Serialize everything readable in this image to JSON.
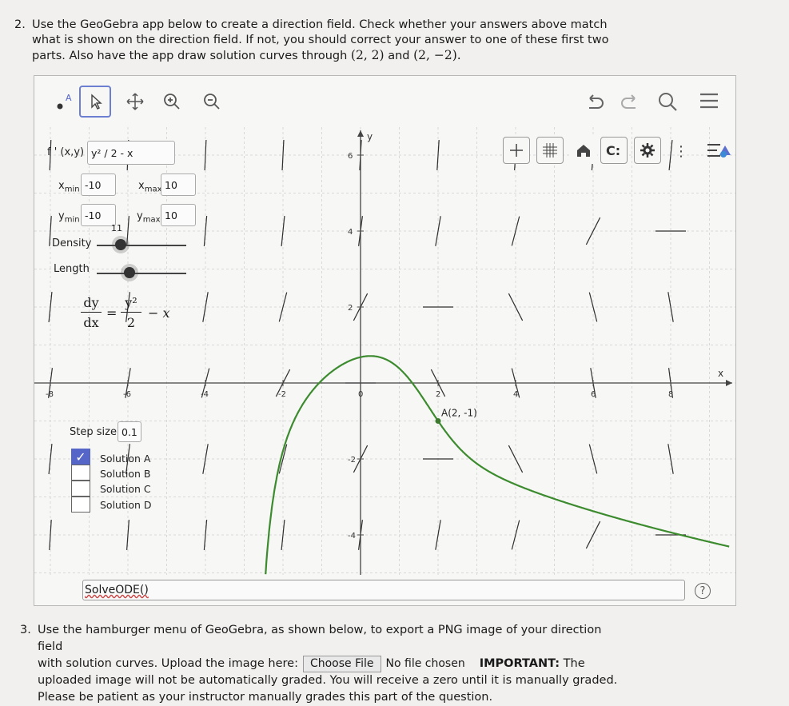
{
  "question2": {
    "number": "2.",
    "line1": "Use the GeoGebra app below to create a direction field. Check whether your answers above match",
    "line2": "what is shown on the direction field. If not, you should correct your answer to one of these first two",
    "line3_pre": "parts. Also have the app draw solution curves through",
    "point1": "(2, 2)",
    "and": "and",
    "point2": "(2, −2).",
    "period": ""
  },
  "toolbar": {
    "tools": [
      "point-tool",
      "move-tool",
      "move-graphics-tool",
      "zoom-in-tool",
      "zoom-out-tool"
    ],
    "point_label": "A",
    "right_tools": [
      "undo",
      "redo",
      "search",
      "menu"
    ]
  },
  "style_bar": [
    "move-graphics",
    "grid",
    "home",
    "label",
    "settings",
    "more",
    "tabs"
  ],
  "sidebar": {
    "function_label": "f ' (x,y) =",
    "function_value": "y² / 2 - x",
    "xmin_label": "x",
    "xmin_sub": "min",
    "xmin_value": "-10",
    "xmax_label": "x",
    "xmax_sub": "max",
    "xmax_value": "10",
    "ymin_label": "y",
    "ymin_sub": "min",
    "ymin_value": "-10",
    "ymax_label": "y",
    "ymax_sub": "max",
    "ymax_value": "10",
    "density_value": "11",
    "density_label": "Density",
    "length_label": "Length",
    "equation_lhs_num": "dy",
    "equation_lhs_den": "dx",
    "equation_eq": "=",
    "equation_rhs_num": "y²",
    "equation_rhs_den": "2",
    "equation_rhs_tail": "− x",
    "step_label": "Step size:",
    "step_value": "0.1",
    "solutions": [
      {
        "label": "Solution A",
        "checked": true
      },
      {
        "label": "Solution B",
        "checked": false
      },
      {
        "label": "Solution C",
        "checked": false
      },
      {
        "label": "Solution D",
        "checked": false
      }
    ]
  },
  "graph": {
    "x_ticks": [
      "-8",
      "-6",
      "-4",
      "-2",
      "0",
      "2",
      "4",
      "6",
      "8"
    ],
    "y_ticks": [
      "6",
      "4",
      "2",
      "-2",
      "-4"
    ],
    "x_axis_label": "x",
    "y_axis_label": "y",
    "point_label": "A(2, -1)",
    "point": {
      "x": 2,
      "y": -1
    }
  },
  "input_bar": {
    "value": "SolveODE()"
  },
  "help_icon_text": "?",
  "question3": {
    "number": "3.",
    "line1": "Use the hamburger menu of GeoGebra, as shown below, to export a PNG image of your direction field",
    "line2_pre": "with solution curves. Upload the image here:",
    "choose_file": "Choose File",
    "no_file": "No file chosen",
    "important": "IMPORTANT:",
    "line2_post": "The",
    "line3": "uploaded image will not be automatically graded. You will receive a zero until it is manually graded.",
    "line4": "Please be patient as your instructor manually grades this part of the question."
  },
  "colors": {
    "curve": "#3d8b2f",
    "point": "#3d7a2f",
    "accent": "#5666c8"
  }
}
